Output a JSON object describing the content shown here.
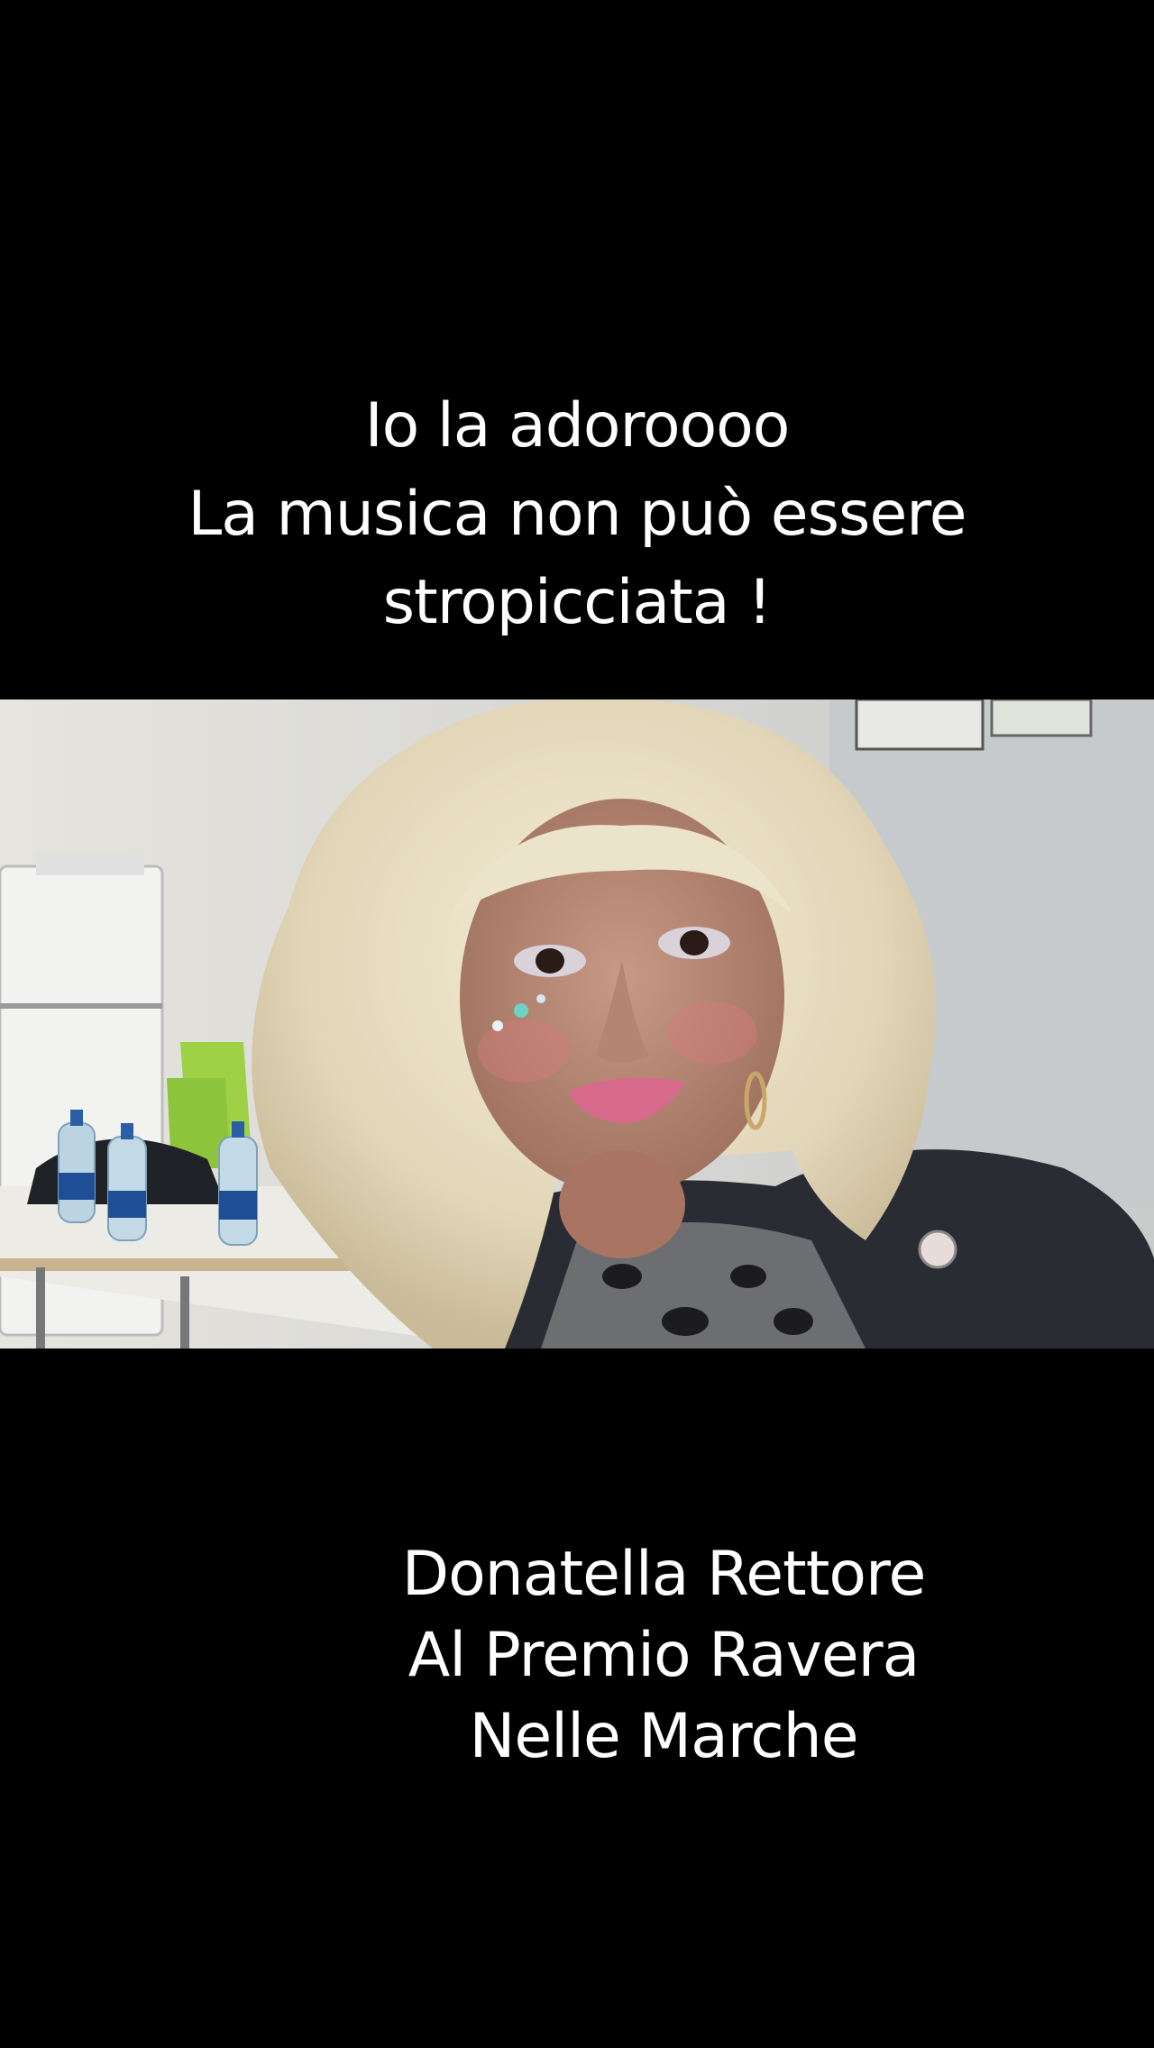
{
  "caption_top": {
    "line1": "Io la adoroooo",
    "line2": "La musica non può essere",
    "line3": "stropicciata !"
  },
  "caption_bottom": {
    "line1": "Donatella Rettore",
    "line2": "Al Premio Ravera",
    "line3": "Nelle Marche"
  },
  "colors": {
    "background": "#000000",
    "text": "#ffffff",
    "hair": "#e6dcc2",
    "wall": "#d9d9d4",
    "jacket": "#2a2c33"
  }
}
